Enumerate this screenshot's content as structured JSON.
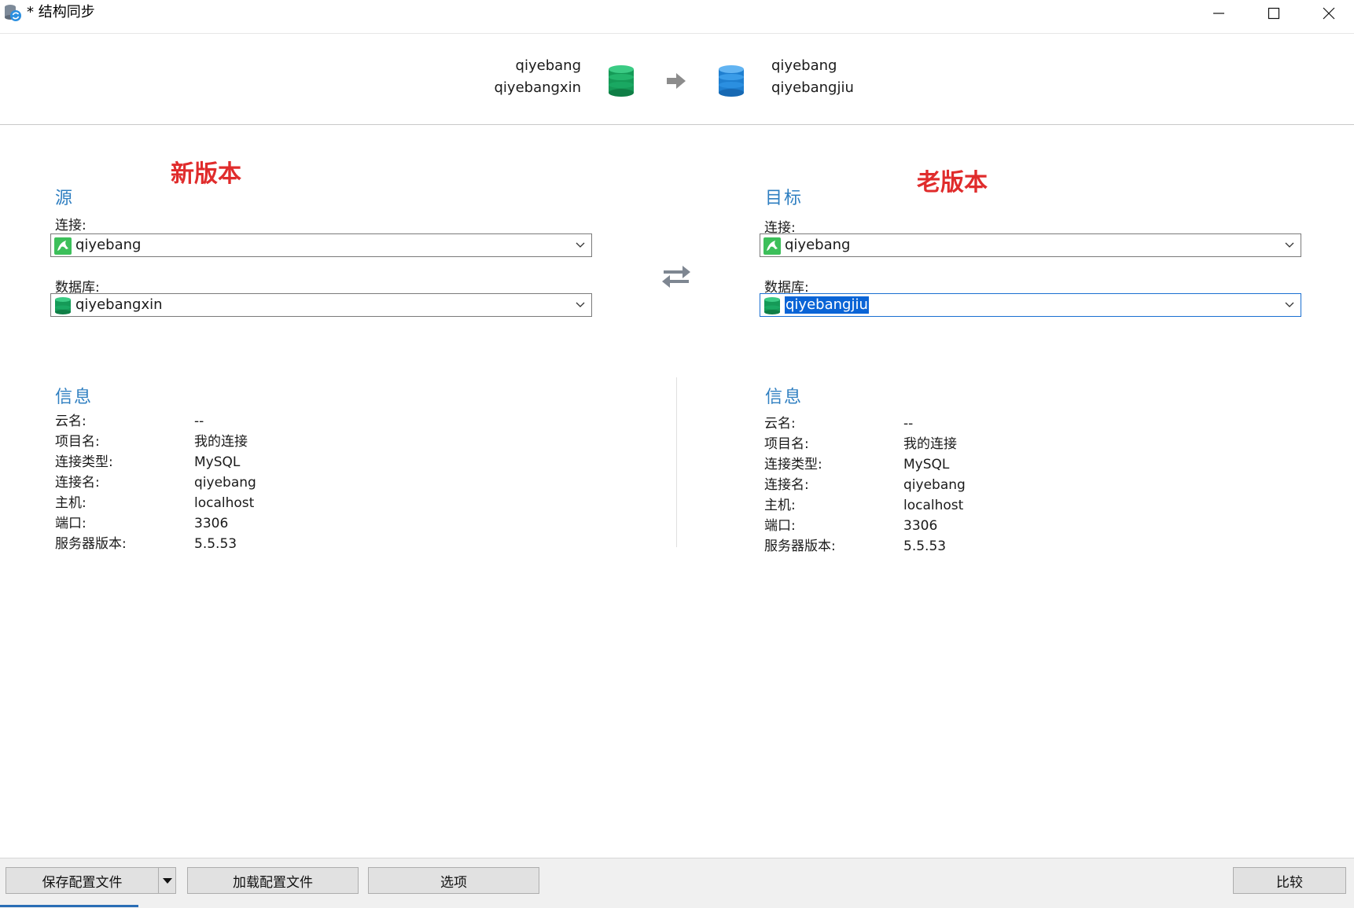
{
  "window": {
    "title": "* 结构同步",
    "controls": {
      "minimize": "minimize",
      "maximize": "maximize",
      "close": "close"
    }
  },
  "header": {
    "source_connection": "qiyebang",
    "source_database": "qiyebangxin",
    "target_connection": "qiyebang",
    "target_database": "qiyebangjiu"
  },
  "source": {
    "annotation": "新版本",
    "title": "源",
    "connection_label": "连接:",
    "connection_value": "qiyebang",
    "database_label": "数据库:",
    "database_value": "qiyebangxin",
    "info_title": "信息",
    "info": [
      {
        "label": "云名:",
        "value": "--"
      },
      {
        "label": "项目名:",
        "value": "我的连接"
      },
      {
        "label": "连接类型:",
        "value": "MySQL"
      },
      {
        "label": "连接名:",
        "value": "qiyebang"
      },
      {
        "label": "主机:",
        "value": "localhost"
      },
      {
        "label": "端口:",
        "value": "3306"
      },
      {
        "label": "服务器版本:",
        "value": "5.5.53"
      }
    ]
  },
  "target": {
    "annotation": "老版本",
    "title": "目标",
    "connection_label": "连接:",
    "connection_value": "qiyebang",
    "database_label": "数据库:",
    "database_value": "qiyebangjiu",
    "info_title": "信息",
    "info": [
      {
        "label": "云名:",
        "value": "--"
      },
      {
        "label": "项目名:",
        "value": "我的连接"
      },
      {
        "label": "连接类型:",
        "value": "MySQL"
      },
      {
        "label": "连接名:",
        "value": "qiyebang"
      },
      {
        "label": "主机:",
        "value": "localhost"
      },
      {
        "label": "端口:",
        "value": "3306"
      },
      {
        "label": "服务器版本:",
        "value": "5.5.53"
      }
    ]
  },
  "footer": {
    "save_profile": "保存配置文件",
    "load_profile": "加载配置文件",
    "options": "选项",
    "compare": "比较"
  },
  "colors": {
    "section_title": "#2f7fc1",
    "annotation": "#e02c2c",
    "source_db": "#1aa862",
    "target_db": "#2b8fe0",
    "selection": "#0a64d6"
  }
}
